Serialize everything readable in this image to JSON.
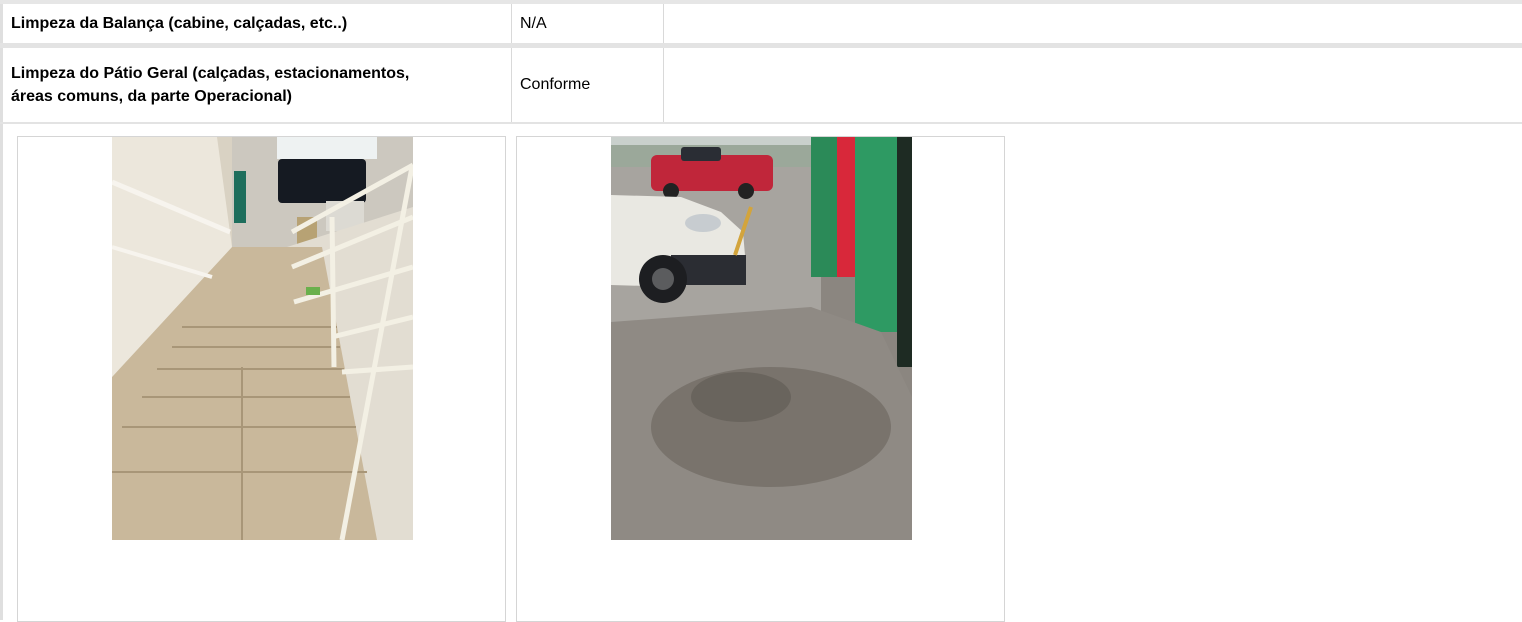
{
  "rows": [
    {
      "label": "Limpeza da Balança (cabine, calçadas, etc..)",
      "status": "N/A"
    },
    {
      "label_line1": "Limpeza do Pátio Geral (calçadas, estacionamentos,",
      "label_line2": "áreas comuns, da parte Operacional)",
      "status": "Conforme"
    }
  ],
  "photos": [
    {
      "subject": "staircase-photo"
    },
    {
      "subject": "parking-pavement-photo"
    }
  ],
  "colors": {
    "separator": "#e3e3e3",
    "border": "#d9d9d9",
    "green_wall": "#2e9a63",
    "red_wall": "#d8283a"
  }
}
